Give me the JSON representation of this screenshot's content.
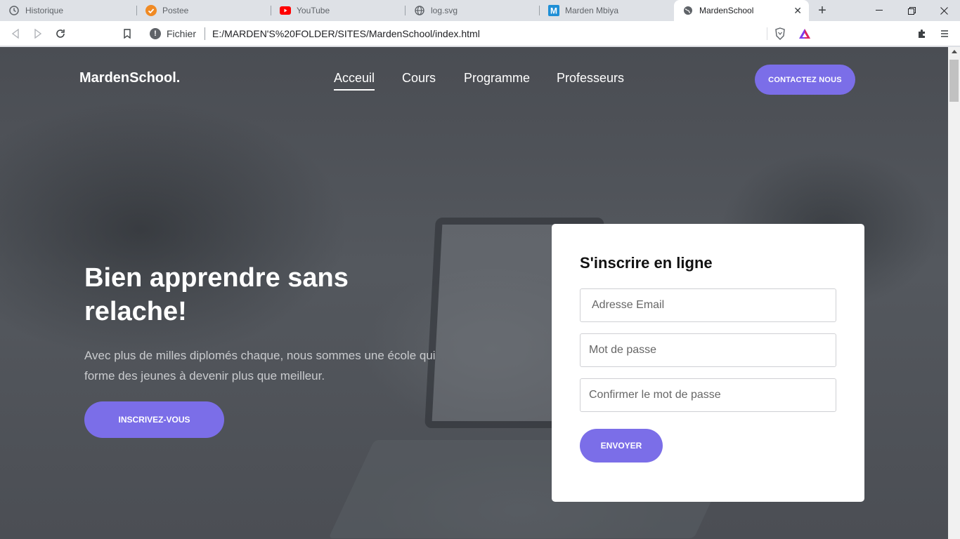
{
  "browser": {
    "tabs": [
      {
        "title": "Historique",
        "icon": "history-icon"
      },
      {
        "title": "Postee",
        "icon": "postee-icon"
      },
      {
        "title": "YouTube",
        "icon": "youtube-icon"
      },
      {
        "title": "log.svg",
        "icon": "globe-icon"
      },
      {
        "title": "Marden Mbiya",
        "icon": "marden-m-icon"
      },
      {
        "title": "MardenSchool",
        "icon": "globe-icon"
      }
    ],
    "address": {
      "scheme": "Fichier",
      "url": "E:/MARDEN'S%20FOLDER/SITES/MardenSchool/index.html"
    }
  },
  "site": {
    "logo": "MardenSchool.",
    "nav": [
      "Acceuil",
      "Cours",
      "Programme",
      "Professeurs"
    ],
    "contact_button": "CONTACTEZ NOUS"
  },
  "hero": {
    "title": "Bien apprendre sans relache!",
    "text": "Avec plus de milles diplomés chaque, nous sommes une école qui forme des jeunes à devenir plus que meilleur.",
    "button": "INSCRIVEZ-VOUS"
  },
  "signup_form": {
    "title": "S'inscrire en ligne",
    "email_placeholder": "Adresse Email",
    "password_placeholder": "Mot de passe",
    "confirm_placeholder": "Confirmer le mot de passe",
    "submit": "ENVOYER"
  },
  "colors": {
    "accent": "#7b6ee8",
    "card": "#ffffff"
  }
}
